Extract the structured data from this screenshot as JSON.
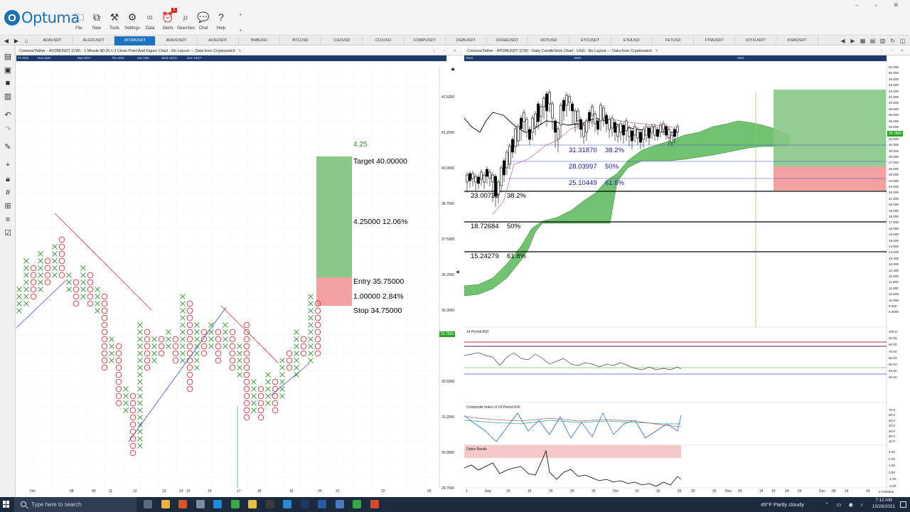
{
  "app": {
    "logo_text": "Optuma",
    "ribbon_buttons": [
      {
        "label": "File",
        "icon": "folder-icon"
      },
      {
        "label": "New",
        "icon": "copy-icon"
      },
      {
        "label": "Tools",
        "icon": "tools-icon"
      },
      {
        "label": "Settings",
        "icon": "gear-icon"
      },
      {
        "label": "Data",
        "icon": "binary-data-icon"
      },
      {
        "label": "Alerts",
        "icon": "alarm-clock-icon",
        "badge": "5"
      },
      {
        "label": "Searches",
        "icon": "search-icon"
      },
      {
        "label": "Chat",
        "icon": "chat-icon"
      },
      {
        "label": "Help",
        "icon": "help-icon"
      }
    ]
  },
  "tabs": [
    {
      "label": "ADAUSDT",
      "active": false
    },
    {
      "label": "ALGOUSDT",
      "active": false
    },
    {
      "label": "ATOMUSDT",
      "active": true
    },
    {
      "label": "AVAXUSDT",
      "active": false
    },
    {
      "label": "AXSUSDT",
      "active": false
    },
    {
      "label": "BNBUSD",
      "active": false
    },
    {
      "label": "BTCUSD",
      "active": false
    },
    {
      "label": "CHZUSD",
      "active": false
    },
    {
      "label": "CLVUSD",
      "active": false
    },
    {
      "label": "COMPUSDT",
      "active": false
    },
    {
      "label": "DGBUSDT",
      "active": false
    },
    {
      "label": "DOGEUSDT",
      "active": false
    },
    {
      "label": "DOTUSD",
      "active": false
    },
    {
      "label": "ETCUSDT",
      "active": false
    },
    {
      "label": "ETHUSD",
      "active": false
    },
    {
      "label": "FETUSD",
      "active": false
    },
    {
      "label": "FTMUSDT",
      "active": false
    },
    {
      "label": "IOTXUSDT",
      "active": false
    },
    {
      "label": "KSMUSDT",
      "active": false
    }
  ],
  "left_chart": {
    "title": "Cosmos/Tether - ATOMUSDT (CW) - 1 Minute $0.25 x 3 Close Point And Figure Chart - No Layout --- Data from Cryptowatch",
    "date_bar": [
      "Fri 6/04",
      "Sun 8/26",
      "Mon 8/27",
      "Thu 9/02",
      "Sat 10/9",
      "Wed 10/13",
      "Sun 10/17"
    ],
    "price_labels": [
      "42.5000",
      "41.2500",
      "40.0000",
      "38.7500",
      "37.5000",
      "36.2500",
      "35.0000",
      "32.5000",
      "31.2500",
      "30.0000",
      "28.7500"
    ],
    "current_price": "33.7500",
    "x_labels": [
      "Oct",
      "08",
      "09",
      "11",
      "12",
      "13",
      "14",
      "15",
      "16",
      "17",
      "18",
      "19",
      "20",
      "21",
      "22",
      "25"
    ],
    "risk_reward": {
      "top_label": "4.25",
      "target": "Target  40.00000",
      "gain": "4.25000   12.06%",
      "entry": "Entry  35.75000",
      "risk": "1.00000   2.84%",
      "stop": "Stop  34.75000"
    }
  },
  "right_chart": {
    "title": "Cosmos/Tether - ATOMUSDT (CW) - Daily CandleStick Chart - USD - No Layout --- Data from Cryptowatch",
    "date_bar": [
      "2019",
      "2020",
      "2021"
    ],
    "price_labels": [
      "52.000",
      "50.000",
      "48.000",
      "46.000",
      "44.000",
      "42.000",
      "40.000",
      "38.000",
      "36.000",
      "35.000",
      "34.000",
      "32.000",
      "31.000",
      "30.000",
      "29.000",
      "28.000",
      "27.000",
      "26.000",
      "25.000",
      "24.000",
      "23.000",
      "22.000",
      "21.000",
      "20.000",
      "19.000",
      "18.000",
      "17.000",
      "16.000",
      "15.500",
      "15.000",
      "14.500",
      "14.000",
      "13.400",
      "13.000",
      "12.400",
      "12.000",
      "11.600",
      "11.000",
      "10.600",
      "10.000",
      "9.600",
      "9.3000"
    ],
    "current_price": "33.7800",
    "fibs": [
      {
        "price": "31.31870",
        "pct": "38.2%"
      },
      {
        "price": "28.03997",
        "pct": "50%"
      },
      {
        "price": "25.10449",
        "pct": "61.8%"
      },
      {
        "price": "23.00723",
        "pct": "38.2%"
      },
      {
        "price": "18.72684",
        "pct": "50%"
      },
      {
        "price": "15.24279",
        "pct": "61.8%"
      }
    ],
    "x_labels": [
      "1",
      "Sep",
      "10",
      "15",
      "20",
      "25",
      "30",
      "Oct",
      "10",
      "15",
      "20",
      "25",
      "30",
      "Nov",
      "09",
      "14",
      "19",
      "24",
      "29",
      "Dec",
      "09",
      "14",
      "19",
      "24"
    ],
    "footer_value": "0.7336616",
    "rsi": {
      "title": "14 Period RSI",
      "labels": [
        "100.0",
        "90.00",
        "80.00",
        "70.00",
        "60.00",
        "50.00",
        "40.00",
        "30.00"
      ]
    },
    "composite": {
      "title": "Composite Index of 14 Period RSI",
      "labels": [
        "70.0",
        "60.0",
        "50.0",
        "40.0",
        "30.0",
        "20.0",
        "10.0"
      ]
    },
    "optex": {
      "title": "Optex Bands",
      "labels": [
        "3.00",
        "2.00",
        "1.00",
        "0.00",
        "-1.00",
        "-2.00"
      ]
    }
  },
  "taskbar": {
    "search_placeholder": "Type here to search",
    "weather": "49°F  Partly cloudy",
    "time": "7:12 AM",
    "date": "10/28/2021"
  },
  "colors": {
    "accent": "#1e73be",
    "x_red": "#d9343a",
    "o_green": "#3a9a3a",
    "reward_green": "#88c888",
    "risk_red": "#f4a0a0",
    "cloud_green": "#58b858"
  }
}
